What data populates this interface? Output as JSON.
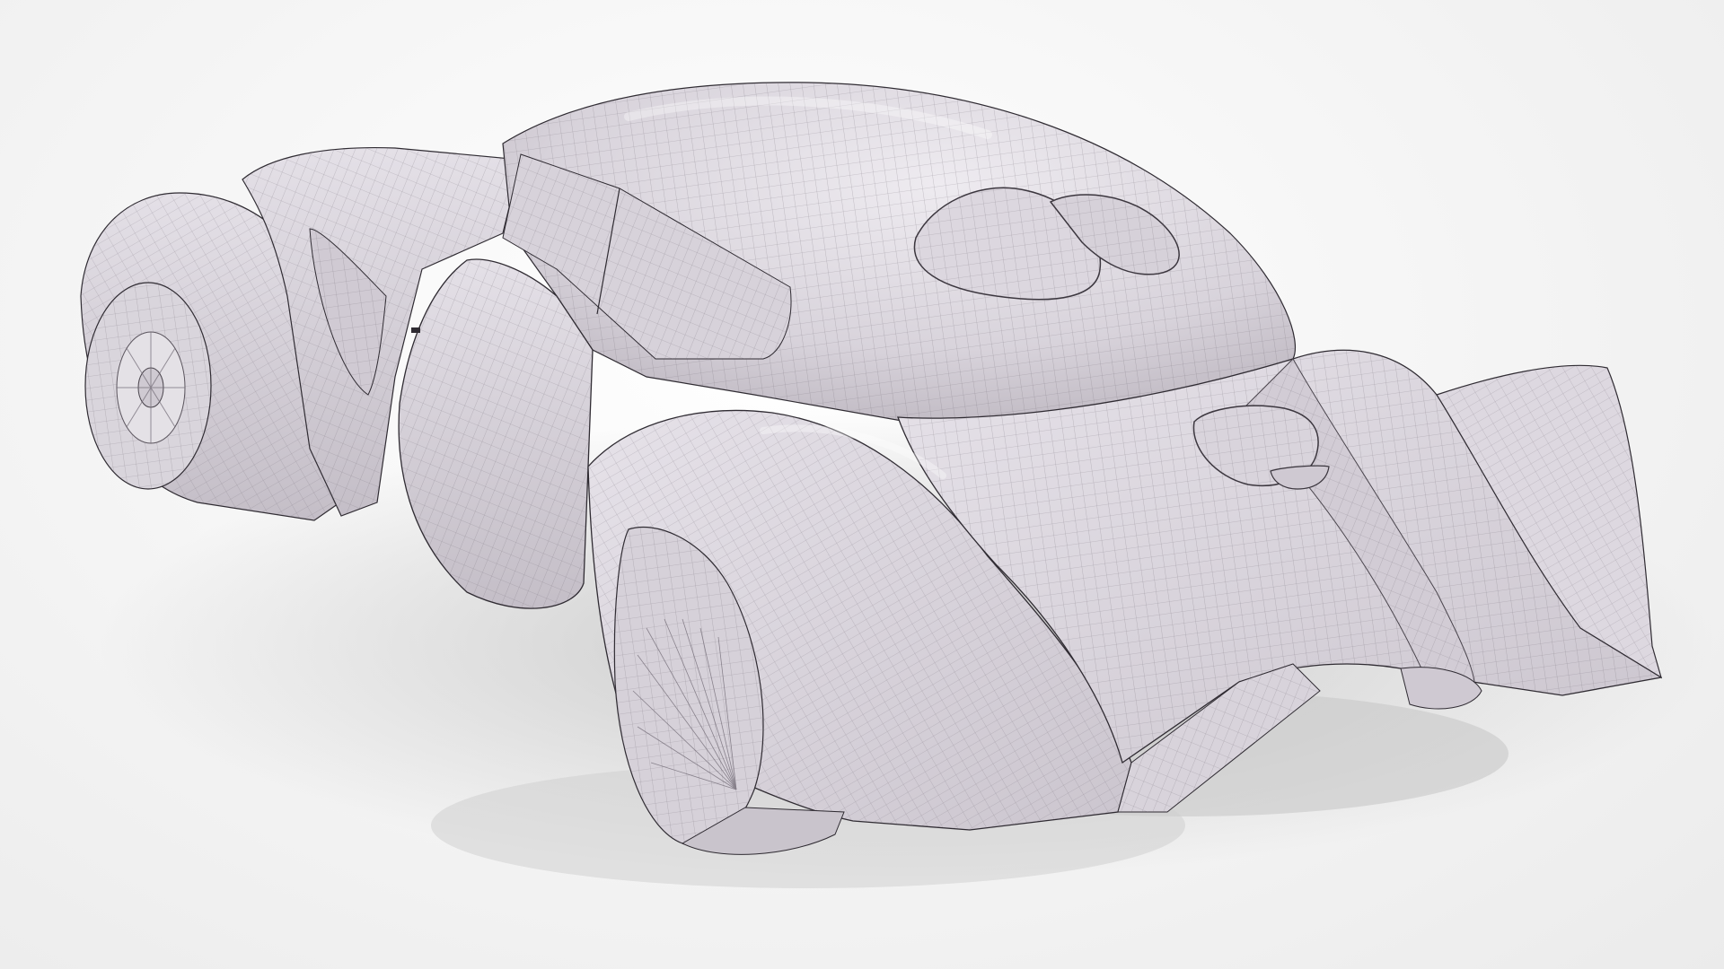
{
  "scene": {
    "subject": "car-wireframe-model",
    "colors": {
      "background": "#f2f2f2",
      "body_light": "#e9e6ec",
      "body_mid": "#d5d0d8",
      "body_dark": "#b7b1ba",
      "wire": "#6f6873",
      "outline": "#2f2b32",
      "shadow": "#c9c9c9"
    }
  }
}
